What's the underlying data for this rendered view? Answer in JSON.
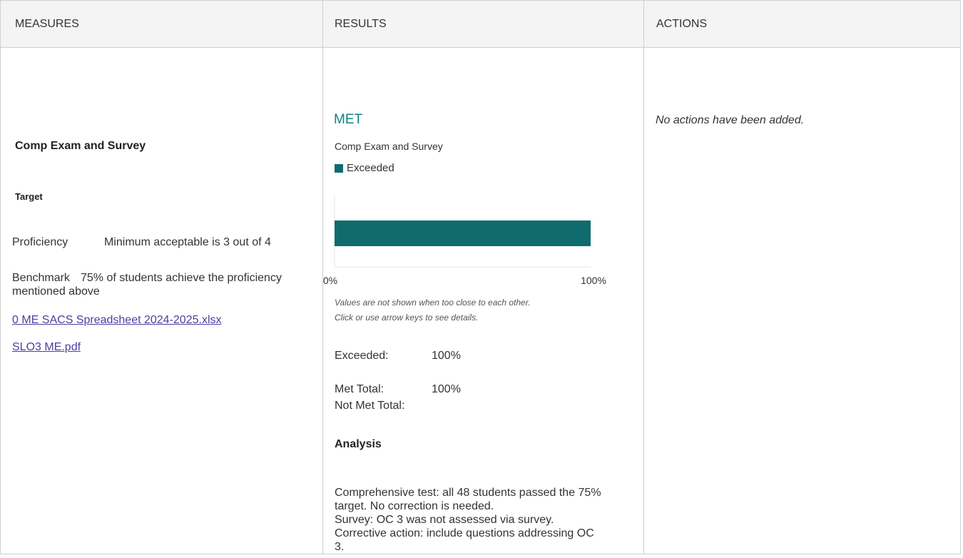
{
  "headers": {
    "measures": "MEASURES",
    "results": "RESULTS",
    "actions": "ACTIONS"
  },
  "measures": {
    "title": "Comp Exam and Survey",
    "target_label": "Target",
    "proficiency_label": "Proficiency",
    "proficiency_text": "Minimum acceptable is 3 out of 4",
    "benchmark_label": "Benchmark",
    "benchmark_text": "75% of students achieve the proficiency mentioned above",
    "links": [
      "0 ME SACS Spreadsheet 2024-2025.xlsx",
      "SLO3 ME.pdf"
    ]
  },
  "results": {
    "status": "MET",
    "measure_name": "Comp Exam and Survey",
    "note_line1": "Values are not shown when too close to each other.",
    "note_line2": "Click or use arrow keys to see details.",
    "rows": {
      "exceeded_label": "Exceeded:",
      "exceeded_value": "100%",
      "met_total_label": "Met Total:",
      "met_total_value": "100%",
      "not_met_total_label": "Not Met Total:"
    },
    "analysis_heading": "Analysis",
    "analysis_text": "Comprehensive test: all 48 students passed the 75% target. No correction is needed.\nSurvey: OC 3 was not assessed via survey. Corrective action: include questions addressing OC 3."
  },
  "chart_data": {
    "type": "bar",
    "orientation": "horizontal",
    "categories": [
      "Comp Exam and Survey"
    ],
    "series": [
      {
        "name": "Exceeded",
        "color": "#0f6b6e",
        "values": [
          100
        ]
      }
    ],
    "xlim": [
      0,
      100
    ],
    "x_tick_labels": [
      "0%",
      "100%"
    ]
  },
  "actions": {
    "empty_text": "No actions have been added."
  },
  "colors": {
    "status": "#138082",
    "bar": "#0f6b6e",
    "link": "#4b3fa0",
    "header_bg": "#f4f4f4",
    "border": "#cfcfcf"
  }
}
